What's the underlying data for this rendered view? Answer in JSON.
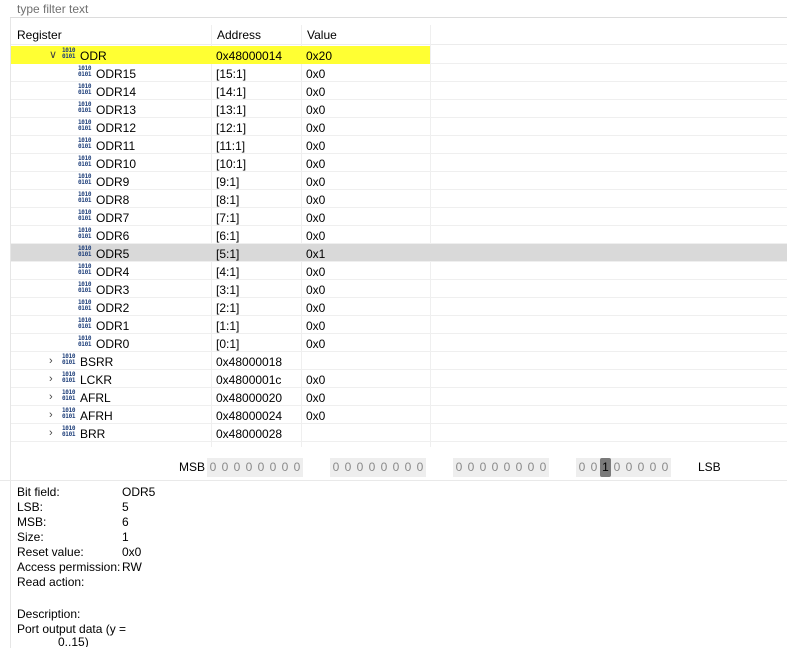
{
  "filter": {
    "placeholder": "type filter text"
  },
  "tree": {
    "columns": [
      "Register",
      "Address",
      "Value"
    ],
    "rows": [
      {
        "level": 0,
        "twisty": "expanded",
        "name": "ODR",
        "address": "0x48000014",
        "value": "0x20",
        "selected": true
      },
      {
        "level": 1,
        "name": "ODR15",
        "address": "[15:1]",
        "value": "0x0"
      },
      {
        "level": 1,
        "name": "ODR14",
        "address": "[14:1]",
        "value": "0x0"
      },
      {
        "level": 1,
        "name": "ODR13",
        "address": "[13:1]",
        "value": "0x0"
      },
      {
        "level": 1,
        "name": "ODR12",
        "address": "[12:1]",
        "value": "0x0"
      },
      {
        "level": 1,
        "name": "ODR11",
        "address": "[11:1]",
        "value": "0x0"
      },
      {
        "level": 1,
        "name": "ODR10",
        "address": "[10:1]",
        "value": "0x0"
      },
      {
        "level": 1,
        "name": "ODR9",
        "address": "[9:1]",
        "value": "0x0"
      },
      {
        "level": 1,
        "name": "ODR8",
        "address": "[8:1]",
        "value": "0x0"
      },
      {
        "level": 1,
        "name": "ODR7",
        "address": "[7:1]",
        "value": "0x0"
      },
      {
        "level": 1,
        "name": "ODR6",
        "address": "[6:1]",
        "value": "0x0"
      },
      {
        "level": 1,
        "name": "ODR5",
        "address": "[5:1]",
        "value": "0x1",
        "hovered": true
      },
      {
        "level": 1,
        "name": "ODR4",
        "address": "[4:1]",
        "value": "0x0"
      },
      {
        "level": 1,
        "name": "ODR3",
        "address": "[3:1]",
        "value": "0x0"
      },
      {
        "level": 1,
        "name": "ODR2",
        "address": "[2:1]",
        "value": "0x0"
      },
      {
        "level": 1,
        "name": "ODR1",
        "address": "[1:1]",
        "value": "0x0"
      },
      {
        "level": 1,
        "name": "ODR0",
        "address": "[0:1]",
        "value": "0x0"
      },
      {
        "level": 0,
        "twisty": "collapsed",
        "name": "BSRR",
        "address": "0x48000018",
        "value": ""
      },
      {
        "level": 0,
        "twisty": "collapsed",
        "name": "LCKR",
        "address": "0x4800001c",
        "value": "0x0"
      },
      {
        "level": 0,
        "twisty": "collapsed",
        "name": "AFRL",
        "address": "0x48000020",
        "value": "0x0"
      },
      {
        "level": 0,
        "twisty": "collapsed",
        "name": "AFRH",
        "address": "0x48000024",
        "value": "0x0"
      },
      {
        "level": 0,
        "twisty": "collapsed",
        "name": "BRR",
        "address": "0x48000028",
        "value": ""
      }
    ]
  },
  "bits": {
    "msb_label": "MSB",
    "lsb_label": "LSB",
    "values": [
      0,
      0,
      0,
      0,
      0,
      0,
      0,
      0,
      0,
      0,
      0,
      0,
      0,
      0,
      0,
      0,
      0,
      0,
      0,
      0,
      0,
      0,
      0,
      0,
      0,
      0,
      1,
      0,
      0,
      0,
      0,
      0
    ],
    "highlight_index": 26
  },
  "details": [
    {
      "key": "Bit field:",
      "value": "ODR5"
    },
    {
      "key": "LSB:",
      "value": "5"
    },
    {
      "key": "MSB:",
      "value": "6"
    },
    {
      "key": "Size:",
      "value": "1"
    },
    {
      "key": "Reset value:",
      "value": "0x0"
    },
    {
      "key": "Access permission:",
      "value": "RW"
    },
    {
      "key": "Read action:",
      "value": ""
    }
  ],
  "description": {
    "label": "Description:",
    "line1": "Port output data (y =",
    "line2": "0..15)"
  },
  "icon_names": {
    "register": "register-binary-icon",
    "field": "bitfield-binary-icon"
  },
  "colors": {
    "selected_row": "#ffff33",
    "hovered_row": "#d9d9d9",
    "bit_on": "#7a7a7a",
    "icon": "#1f3f7a"
  }
}
